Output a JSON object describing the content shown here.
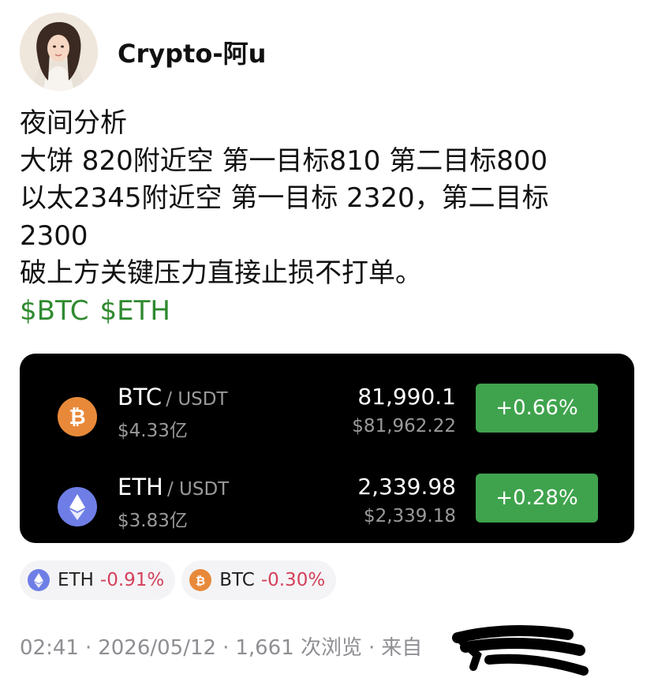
{
  "author": {
    "name": "Crypto-阿u"
  },
  "post": {
    "lines": [
      "夜间分析",
      "大饼 820附近空 第一目标810 第二目标800",
      "以太2345附近空 第一目标 2320，第二目标",
      "2300",
      "破上方关键压力直接止损不打单。"
    ],
    "tags": [
      "$BTC",
      "$ETH"
    ]
  },
  "market": {
    "rows": [
      {
        "symbol": "BTC",
        "quote": "/ USDT",
        "volume": "$4.33亿",
        "price": "81,990.1",
        "usd_price": "$81,962.22",
        "change": "+0.66%",
        "icon": "bitcoin-icon"
      },
      {
        "symbol": "ETH",
        "quote": "/ USDT",
        "volume": "$3.83亿",
        "price": "2,339.98",
        "usd_price": "$2,339.18",
        "change": "+0.28%",
        "icon": "ethereum-icon"
      }
    ],
    "colors": {
      "positive": "#3fa34d",
      "btc": "#e8893a",
      "eth": "#6e7ee6"
    }
  },
  "chips": [
    {
      "symbol": "ETH",
      "change": "-0.91%",
      "icon": "ethereum-icon"
    },
    {
      "symbol": "BTC",
      "change": "-0.30%",
      "icon": "bitcoin-icon"
    }
  ],
  "footer": {
    "time": "02:41",
    "date": "2026/05/12",
    "views": "1,661 次浏览",
    "source": "来自"
  }
}
